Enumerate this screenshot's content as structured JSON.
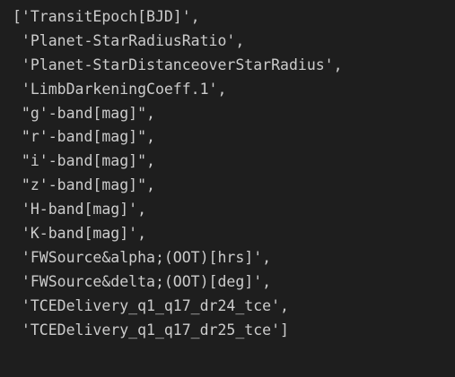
{
  "output": {
    "lines": [
      "['TransitEpoch[BJD]',",
      " 'Planet-StarRadiusRatio',",
      " 'Planet-StarDistanceoverStarRadius',",
      " 'LimbDarkeningCoeff.1',",
      " \"g'-band[mag]\",",
      " \"r'-band[mag]\",",
      " \"i'-band[mag]\",",
      " \"z'-band[mag]\",",
      " 'H-band[mag]',",
      " 'K-band[mag]',",
      " 'FWSource&alpha;(OOT)[hrs]',",
      " 'FWSource&delta;(OOT)[deg]',",
      " 'TCEDelivery_q1_q17_dr24_tce',",
      " 'TCEDelivery_q1_q17_dr25_tce']"
    ]
  },
  "colors": {
    "background": "#1e1e1e",
    "text": "#cccccc"
  }
}
